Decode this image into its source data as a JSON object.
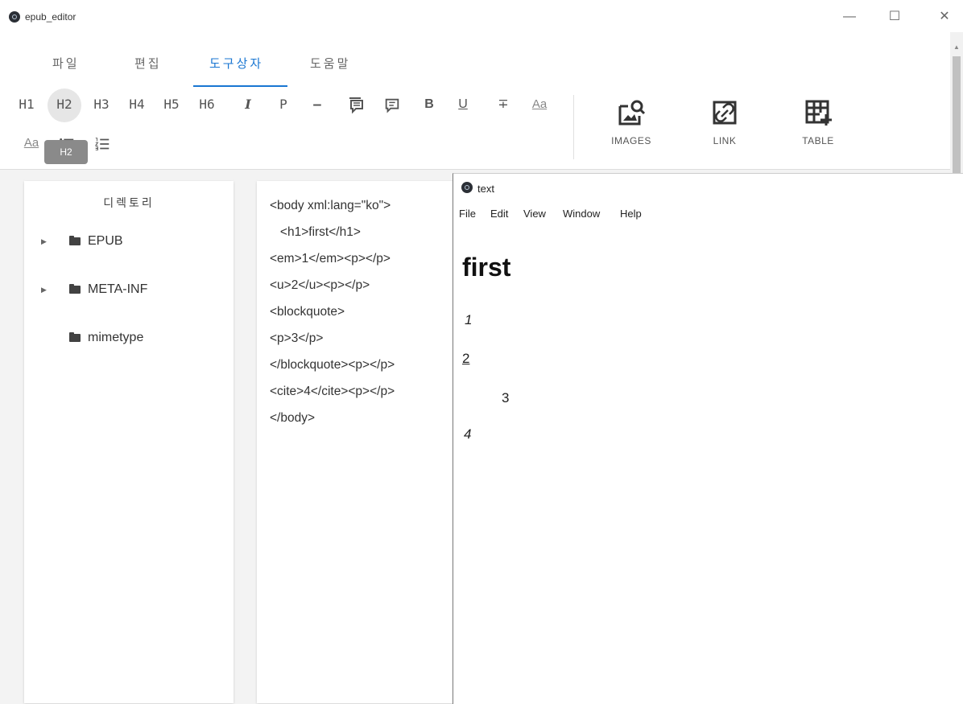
{
  "window": {
    "title": "epub_editor",
    "minimize": "—",
    "maximize": "☐",
    "close": "✕"
  },
  "menu_tabs": [
    {
      "label": "파일"
    },
    {
      "label": "편집"
    },
    {
      "label": "도구상자",
      "active": true
    },
    {
      "label": "도움말"
    }
  ],
  "toolbar": {
    "h1": "H1",
    "h2": "H2",
    "h3": "H3",
    "h4": "H4",
    "h5": "H5",
    "h6": "H6",
    "italic": "I",
    "paragraph": "P",
    "hr": "—",
    "bold": "B",
    "underline": "U",
    "strike": "∓",
    "font_size": "Aa",
    "font_color": "Aa",
    "tooltip": "H2",
    "images_label": "IMAGES",
    "link_label": "LINK",
    "table_label": "TABLE"
  },
  "directory": {
    "title": "디렉토리",
    "items": [
      {
        "label": "EPUB",
        "expandable": true
      },
      {
        "label": "META-INF",
        "expandable": true
      },
      {
        "label": "mimetype",
        "expandable": false
      }
    ]
  },
  "code": {
    "lines": [
      "<body xml:lang=\"ko\">",
      "   <h1>first</h1>",
      "<em>1</em><p></p>",
      "<u>2</u><p></p>",
      "<blockquote>",
      "<p>3</p>",
      "</blockquote><p></p>",
      "<cite>4</cite><p></p>",
      "</body>"
    ]
  },
  "preview": {
    "title": "text",
    "menu": [
      "File",
      "Edit",
      "View",
      "Window",
      "Help"
    ],
    "h1": "first",
    "em": "1",
    "u": "2",
    "blockquote": "3",
    "cite": "4"
  },
  "colors": {
    "accent": "#1976d2"
  }
}
